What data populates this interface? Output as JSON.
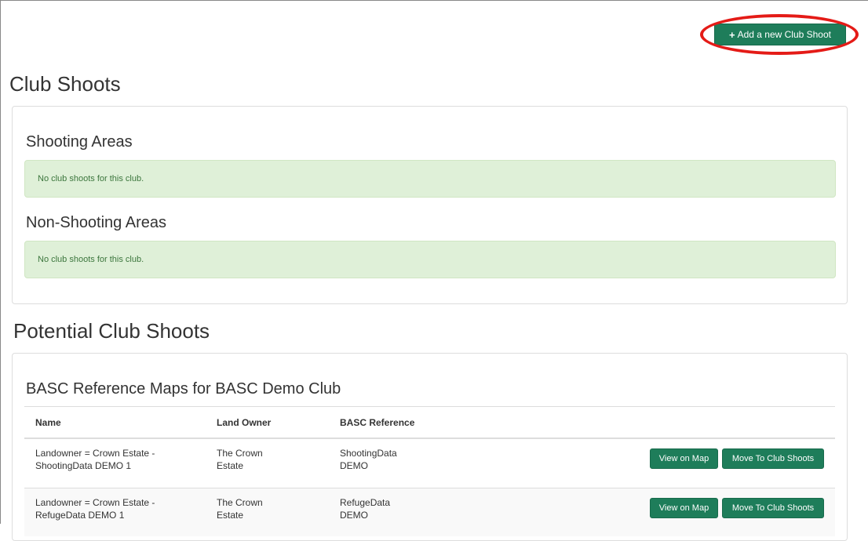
{
  "header": {
    "add_button_label": "Add a new Club Shoot",
    "add_button_icon": "plus-icon"
  },
  "club_shoots": {
    "title": "Club Shoots",
    "shooting_areas": {
      "title": "Shooting Areas",
      "message": "No club shoots for this club."
    },
    "non_shooting_areas": {
      "title": "Non-Shooting Areas",
      "message": "No club shoots for this club."
    }
  },
  "potential": {
    "title": "Potential Club Shoots",
    "panel_title": "BASC Reference Maps for BASC Demo Club",
    "columns": [
      "Name",
      "Land Owner",
      "BASC Reference"
    ],
    "rows": [
      {
        "name_line1": "Landowner = Crown Estate -",
        "name_line2": "ShootingData DEMO 1",
        "owner_line1": "The Crown",
        "owner_line2": "Estate",
        "ref_line1": "ShootingData",
        "ref_line2": "DEMO",
        "view_label": "View on Map",
        "move_label": "Move To Club Shoots"
      },
      {
        "name_line1": "Landowner = Crown Estate -",
        "name_line2": "RefugeData DEMO 1",
        "owner_line1": "The Crown",
        "owner_line2": "Estate",
        "ref_line1": "RefugeData",
        "ref_line2": "DEMO",
        "view_label": "View on Map",
        "move_label": "Move To Club Shoots"
      }
    ]
  },
  "colors": {
    "primary_button": "#1e7d5a",
    "success_alert_bg": "#dff0d8",
    "success_alert_text": "#3c763d",
    "highlight_ring": "#e41b17"
  }
}
